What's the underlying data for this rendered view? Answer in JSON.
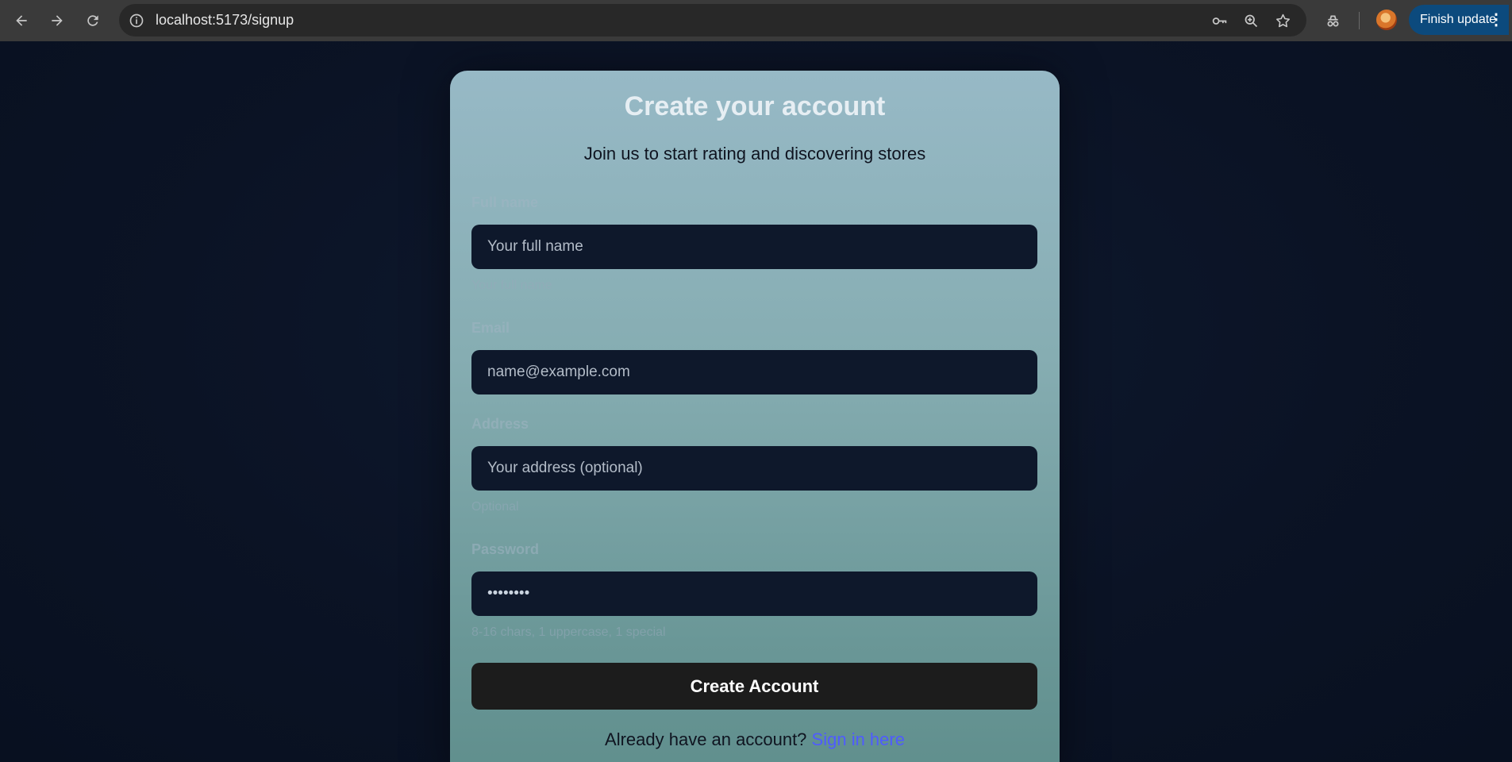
{
  "browser": {
    "url": "localhost:5173/signup",
    "update_label": "Finish update",
    "update_menu": "⋮"
  },
  "form": {
    "title": "Create your account",
    "subtitle": "Join us to start rating and discovering stores",
    "name": {
      "label": "Full name",
      "placeholder": "Your full name",
      "hint": "Your full name"
    },
    "email": {
      "label": "Email",
      "placeholder": "name@example.com"
    },
    "address": {
      "label": "Address",
      "placeholder": "Your address (optional)",
      "hint": "Optional"
    },
    "password": {
      "label": "Password",
      "value": "••••••••",
      "hint": "8-16 chars, 1 uppercase, 1 special"
    },
    "submit_label": "Create Account",
    "signin_prompt": "Already have an account?",
    "signin_link": "Sign in here"
  },
  "colors": {
    "accent_link": "#4f5bff",
    "input_bg": "#0e182b",
    "button_bg": "#1c1c1c",
    "update_btn": "#0c4a7d"
  }
}
